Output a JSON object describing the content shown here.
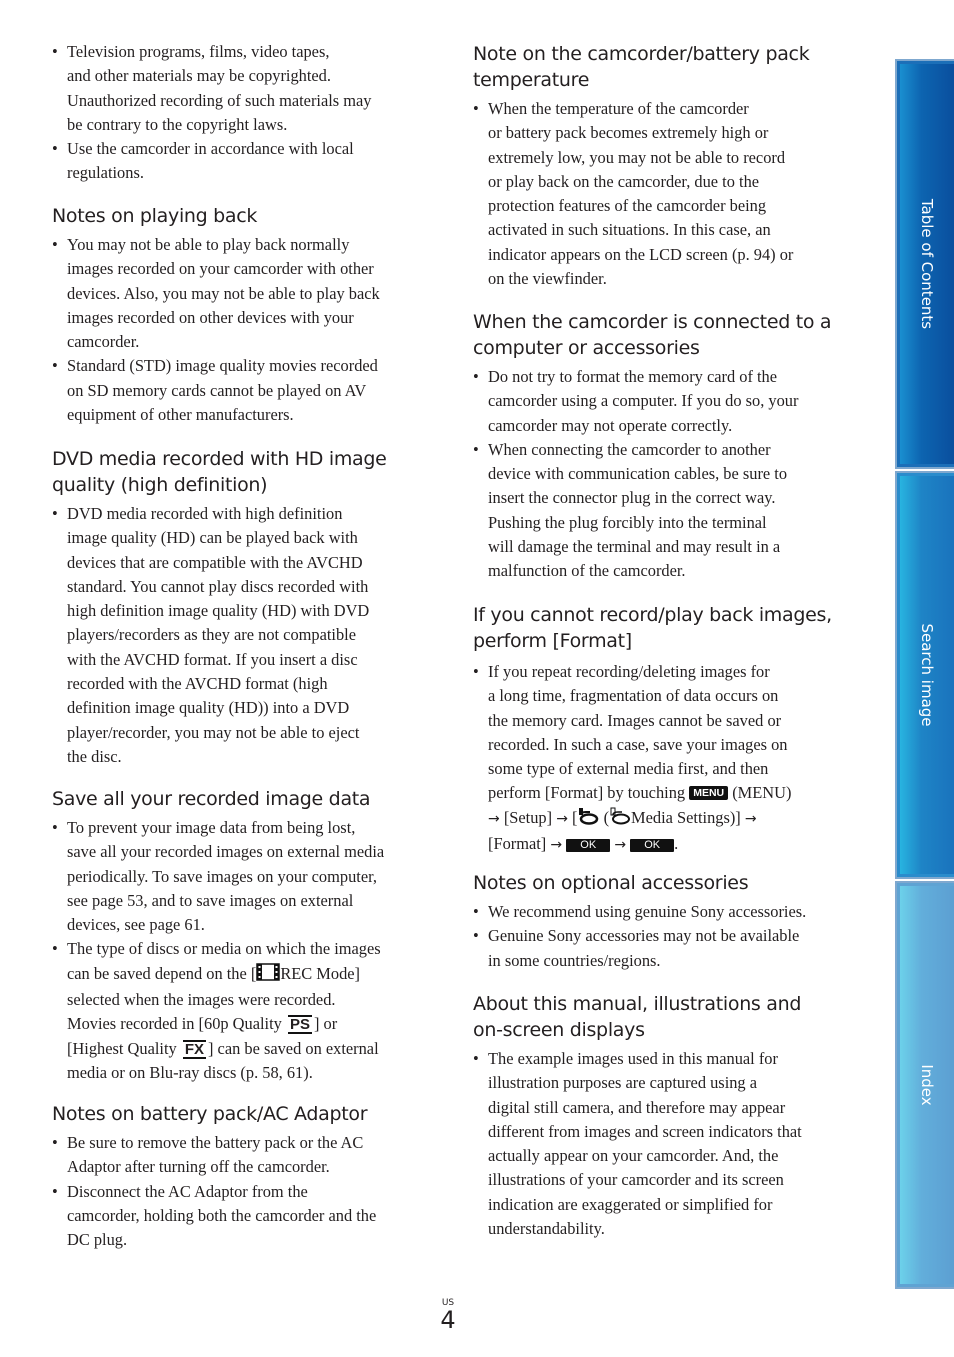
{
  "left_column": {
    "intro_bullets": [
      [
        "Television programs, films, video tapes,",
        "and other materials may be copyrighted.",
        "Unauthorized recording of such materials may",
        "be contrary to the copyright laws."
      ],
      [
        "Use the camcorder in accordance with local",
        "regulations."
      ]
    ],
    "sections": [
      {
        "heading": [
          "Notes on playing back"
        ],
        "bullets": [
          [
            "You may not be able to play back normally",
            "images recorded on your camcorder with other",
            "devices. Also, you may not be able to play back",
            "images recorded on other devices with your",
            "camcorder."
          ],
          [
            "Standard (STD) image quality movies recorded",
            "on SD memory cards cannot be played on AV",
            "equipment of other manufacturers."
          ]
        ]
      },
      {
        "heading": [
          "DVD media recorded with HD image",
          "quality (high definition)"
        ],
        "bullets": [
          [
            "DVD media recorded with high definition",
            "image quality (HD) can be played back with",
            "devices that are compatible with the AVCHD",
            "standard. You cannot play discs recorded with",
            "high definition image quality (HD) with DVD",
            "players/recorders as they are not compatible",
            "with the AVCHD format. If you insert a disc",
            "recorded with the AVCHD format (high",
            "definition image quality (HD)) into a DVD",
            "player/recorder, you may not be able to eject",
            "the disc."
          ]
        ]
      },
      {
        "heading": [
          "Save all your recorded image data"
        ],
        "bullets": [
          [
            "To prevent your image data from being lost,",
            "save all your recorded images on external media",
            "periodically. To save images on your computer,",
            "see page 53, and to save images on external",
            "devices, see page 61."
          ]
        ],
        "rec_mode_bullet": {
          "line1": "The type of discs or media on which the images",
          "line2_pre": "can be saved depend on the [",
          "line2_icon": "film-reel-icon",
          "line2_post": "REC Mode]",
          "line3": "selected when the images were recorded.",
          "line4_pre": "Movies recorded in [60p Quality ",
          "line4_badge": "PS",
          "line4_post": "] or",
          "line5_pre": "[Highest Quality ",
          "line5_badge": "FX",
          "line5_post": "] can be saved on external",
          "line6": "media or on Blu-ray discs (p. 58, 61)."
        }
      },
      {
        "heading": [
          "Notes on battery pack/AC Adaptor"
        ],
        "bullets": [
          [
            "Be sure to remove the battery pack or the AC",
            "Adaptor after turning off the camcorder."
          ],
          [
            "Disconnect the AC Adaptor from the",
            "camcorder, holding both the camcorder and the",
            "DC plug."
          ]
        ]
      }
    ]
  },
  "right_column": {
    "sections": [
      {
        "heading": [
          "Note on the camcorder/battery pack",
          "temperature"
        ],
        "bullets": [
          [
            "When the temperature of the camcorder",
            "or battery pack becomes extremely high or",
            "extremely low, you may not be able to record",
            "or play back on the camcorder, due to the",
            "protection features of the camcorder being",
            "activated in such situations. In this case, an",
            "indicator appears on the LCD screen (p. 94) or",
            "on the viewfinder."
          ]
        ]
      },
      {
        "heading": [
          "When the camcorder is connected to a",
          "computer or accessories"
        ],
        "bullets": [
          [
            "Do not try to format the memory card of the",
            "camcorder using a computer. If you do so, your",
            "camcorder may not operate correctly."
          ],
          [
            "When connecting the camcorder to another",
            "device with communication cables, be sure to",
            "insert the connector plug in the correct way.",
            "Pushing the plug forcibly into the terminal",
            "will damage the terminal and may result in a",
            "malfunction of the camcorder."
          ]
        ]
      },
      {
        "heading": [
          "If you cannot record/play back images,",
          "perform [Format]"
        ],
        "format_bullet": {
          "lines": [
            "If you repeat recording/deleting images for",
            "a long time, fragmentation of data occurs on",
            "the memory card. Images cannot be saved or",
            "recorded. In such a case, save your images on",
            "some type of external media first, and then"
          ],
          "line6_pre": "perform [Format] by touching ",
          "menu_badge": "MENU",
          "line6_post": " (MENU)",
          "arrow": "→",
          "setup": " [Setup] ",
          "bracket_open": " [",
          "paren_open": " (",
          "media_settings": "Media Settings)] ",
          "format": "[Format] ",
          "ok_badge": "OK",
          "end": "."
        }
      },
      {
        "heading": [
          "Notes on optional accessories"
        ],
        "bullets": [
          [
            "We recommend using genuine Sony accessories."
          ],
          [
            "Genuine Sony accessories may not be available",
            "in some countries/regions."
          ]
        ]
      },
      {
        "heading": [
          "About this manual, illustrations and",
          "on-screen displays"
        ],
        "bullets": [
          [
            "The example images used in this manual for",
            "illustration purposes are captured using a",
            "digital still camera, and therefore may appear",
            "different from images and screen indicators that",
            "actually appear on your camcorder. And, the",
            "illustrations of your camcorder and its screen",
            "indication are exaggerated or simplified for",
            "understandability."
          ]
        ]
      }
    ]
  },
  "side_tabs": [
    "Table of Contents",
    "Search image",
    "Index"
  ],
  "footer": {
    "region": "US",
    "page_number": "4"
  },
  "colors": {
    "text": "#231f20",
    "tab_dark": "#0a4f9e",
    "tab_mid": "#1e84c6",
    "tab_light": "#62aedb"
  }
}
